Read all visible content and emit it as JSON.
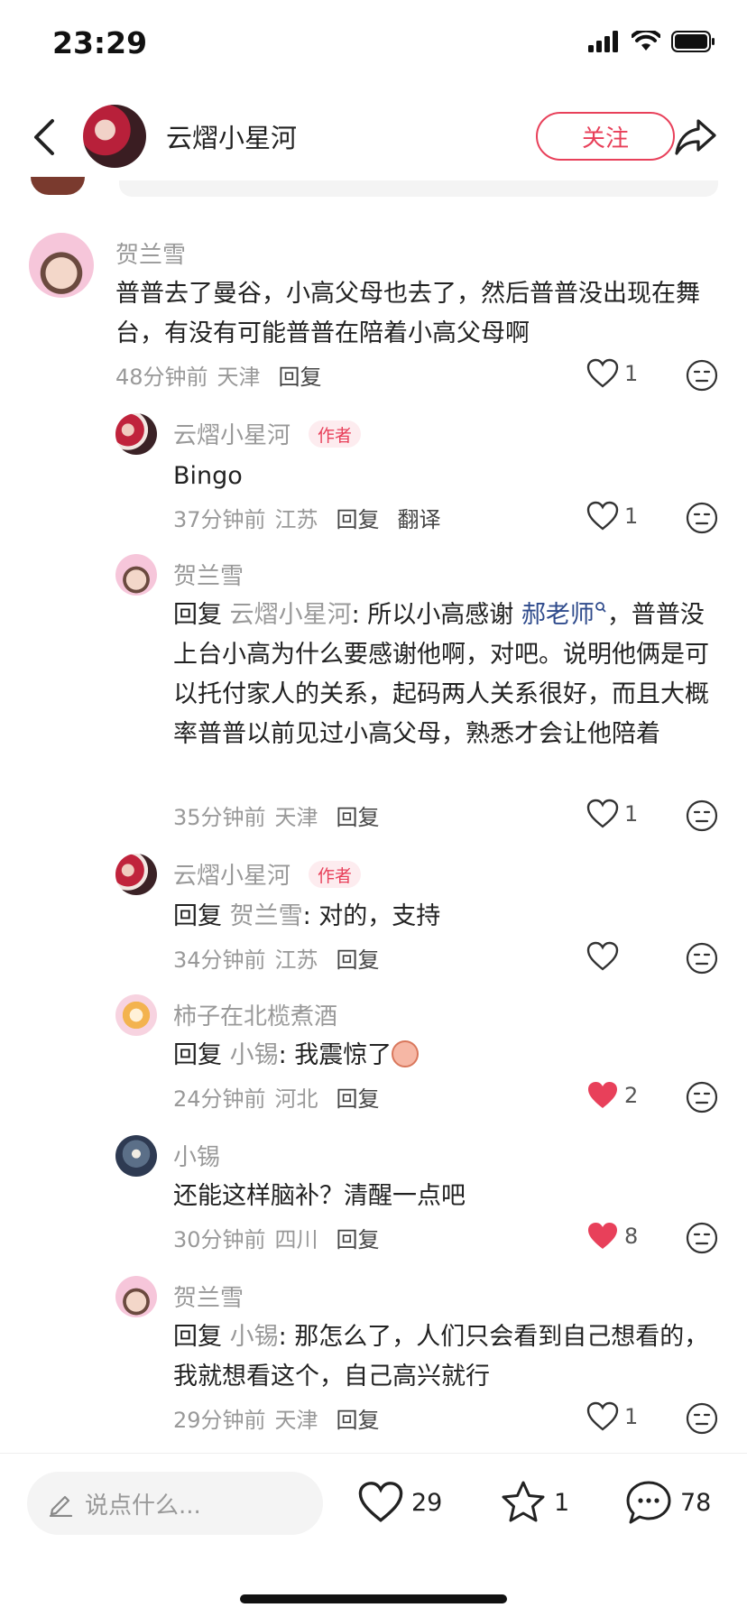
{
  "status_bar": {
    "time": "23:29"
  },
  "header": {
    "title": "云熠小星河",
    "follow_label": "关注"
  },
  "comments": [
    {
      "name": "贺兰雪",
      "text": "普普去了曼谷，小高父母也去了，然后普普没出现在舞台，有没有可能普普在陪着小高父母啊",
      "time": "48分钟前",
      "location": "天津",
      "reply_label": "回复",
      "likes": "1",
      "liked": false
    },
    {
      "name": "云熠小星河",
      "author_tag": "作者",
      "text": "Bingo",
      "time": "37分钟前",
      "location": "江苏",
      "reply_label": "回复",
      "translate_label": "翻译",
      "likes": "1",
      "liked": false
    },
    {
      "name": "贺兰雪",
      "reply_prefix": "回复",
      "reply_to": "云熠小星河",
      "text_before_link": "所以小高感谢 ",
      "link": "郝老师",
      "text_after_link": "，普普没上台小高为什么要感谢他啊，对吧。说明他俩是可以托付家人的关系，起码两人关系很好，而且大概率普普以前见过小高父母，熟悉才会让他陪着",
      "time": "35分钟前",
      "location": "天津",
      "reply_label": "回复",
      "likes": "1",
      "liked": false
    },
    {
      "name": "云熠小星河",
      "author_tag": "作者",
      "reply_prefix": "回复",
      "reply_to": "贺兰雪",
      "text": "对的，支持",
      "time": "34分钟前",
      "location": "江苏",
      "reply_label": "回复",
      "likes": "",
      "liked": false
    },
    {
      "name": "柿子在北榄煮酒",
      "reply_prefix": "回复",
      "reply_to": "小锡",
      "text": "我震惊了",
      "time": "24分钟前",
      "location": "河北",
      "reply_label": "回复",
      "likes": "2",
      "liked": true
    },
    {
      "name": "小锡",
      "text": "还能这样脑补？清醒一点吧",
      "time": "30分钟前",
      "location": "四川",
      "reply_label": "回复",
      "likes": "8",
      "liked": true
    },
    {
      "name": "贺兰雪",
      "reply_prefix": "回复",
      "reply_to": "小锡",
      "text": "那怎么了，人们只会看到自己想看的，我就想看这个，自己高兴就行",
      "time": "29分钟前",
      "location": "天津",
      "reply_label": "回复",
      "likes": "1",
      "liked": false
    }
  ],
  "bottom_bar": {
    "input_placeholder": "说点什么...",
    "like_count": "29",
    "star_count": "1",
    "comment_count": "78"
  },
  "colors": {
    "accent": "#e8405a",
    "link": "#2f4b8c",
    "muted": "#999999"
  }
}
